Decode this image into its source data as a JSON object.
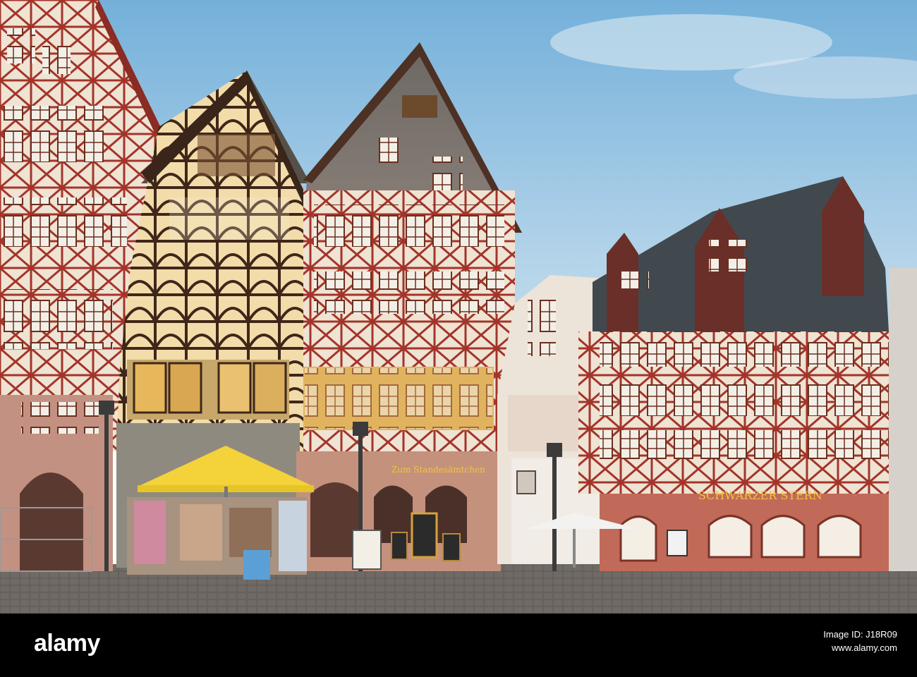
{
  "photo": {
    "description_alt": "Half-timbered houses around the Römerberg square",
    "signs": {
      "shop_sign": "Zum Standesämtchen",
      "restaurant_sign": "SCHWARZER STERN"
    }
  },
  "footer": {
    "brand": "alamy",
    "image_id_label": "Image ID: J18R09",
    "site_url": "www.alamy.com"
  },
  "colors": {
    "sky_top": "#7fb7dd",
    "sky_bottom": "#cfe3ee",
    "timber_red": "#a8322a",
    "timber_dark": "#4a2e1c",
    "plaster": "#efe6d8",
    "umbrella_yellow": "#f4d23a",
    "cobblestone": "#6f6a66"
  }
}
